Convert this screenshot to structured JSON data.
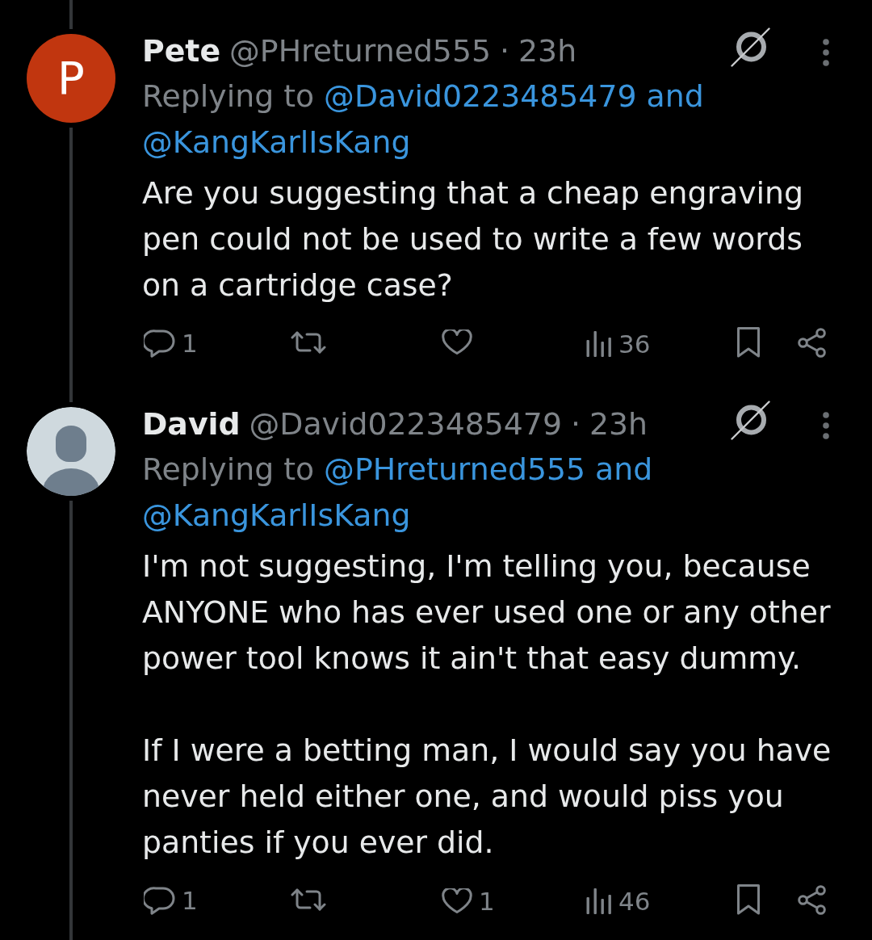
{
  "tweets": [
    {
      "avatar": {
        "kind": "letter",
        "letter": "P"
      },
      "name": "Pete",
      "handle": "@PHreturned555",
      "separator": "·",
      "time": "23h",
      "replying": {
        "prefix": "Replying to",
        "mentions": [
          "@David0223485479",
          "@KangKarlIsKang"
        ],
        "joiner": "and"
      },
      "body": [
        "Are you suggesting that a cheap engraving pen could not be used to write a few words on a cartridge case?"
      ],
      "actions": [
        {
          "kind": "reply",
          "count": "1"
        },
        {
          "kind": "repost"
        },
        {
          "kind": "like"
        },
        {
          "kind": "views",
          "count": "36"
        },
        {
          "kind": "bookmark"
        },
        {
          "kind": "share"
        }
      ]
    },
    {
      "avatar": {
        "kind": "default"
      },
      "name": "David",
      "handle": "@David0223485479",
      "separator": "·",
      "time": "23h",
      "replying": {
        "prefix": "Replying to",
        "mentions": [
          "@PHreturned555",
          "@KangKarlIsKang"
        ],
        "joiner": "and"
      },
      "body": [
        "I'm not suggesting, I'm telling you, because ANYONE who has ever used one or any other power tool knows it ain't that easy dummy.",
        "If I were a betting man, I would say you have never held either one, and would piss you panties if you ever did."
      ],
      "actions": [
        {
          "kind": "reply",
          "count": "1"
        },
        {
          "kind": "repost"
        },
        {
          "kind": "like",
          "count": "1"
        },
        {
          "kind": "views",
          "count": "46"
        },
        {
          "kind": "bookmark"
        },
        {
          "kind": "share"
        }
      ]
    }
  ]
}
